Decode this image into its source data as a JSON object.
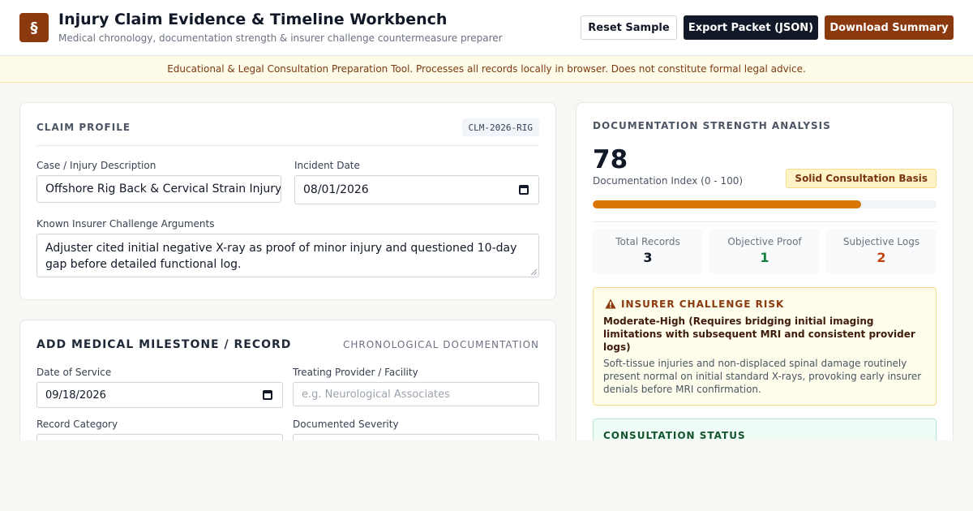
{
  "header": {
    "logo_glyph": "§",
    "title": "Injury Claim Evidence & Timeline Workbench",
    "subtitle": "Medical chronology, documentation strength & insurer challenge countermeasure preparer",
    "reset_label": "Reset Sample",
    "export_label": "Export Packet (JSON)",
    "download_label": "Download Summary"
  },
  "notice": "Educational & Legal Consultation Preparation Tool. Processes all records locally in browser. Does not constitute formal legal advice.",
  "profile": {
    "section_title": "CLAIM PROFILE",
    "case_id": "CLM-2026-RIG",
    "description_label": "Case / Injury Description",
    "description_value": "Offshore Rig Back & Cervical Strain Injury",
    "incident_label": "Incident Date",
    "incident_value": "08/01/2026",
    "challenge_label": "Known Insurer Challenge Arguments",
    "challenge_value": "Adjuster cited initial negative X-ray as proof of minor injury and questioned 10-day gap before detailed functional log."
  },
  "add_record": {
    "title": "ADD MEDICAL MILESTONE / RECORD",
    "meta": "CHRONOLOGICAL DOCUMENTATION",
    "date_label": "Date of Service",
    "date_value": "09/18/2026",
    "provider_label": "Treating Provider / Facility",
    "provider_placeholder": "e.g. Neurological Associates",
    "category_label": "Record Category",
    "severity_label": "Documented Severity"
  },
  "analysis": {
    "section_title": "DOCUMENTATION STRENGTH ANALYSIS",
    "score": "78",
    "score_label": "Documentation Index (0 - 100)",
    "score_fraction": 0.78,
    "basis_badge": "Solid Consultation Basis",
    "stats": [
      {
        "label": "Total Records",
        "value": "3",
        "color": "#111827"
      },
      {
        "label": "Objective Proof",
        "value": "1",
        "color": "#15803d"
      },
      {
        "label": "Subjective Logs",
        "value": "2",
        "color": "#c2410c"
      }
    ],
    "risk_title": "INSURER CHALLENGE RISK",
    "risk_level": "Moderate-High (Requires bridging initial imaging limitations with subsequent MRI and consistent provider logs)",
    "risk_desc": "Soft-tissue injuries and non-displaced spinal damage routinely present normal on initial standard X-rays, provoking early insurer denials before MRI confirmation.",
    "consult_title": "CONSULTATION STATUS"
  },
  "colors": {
    "brand": "#8b3a0f",
    "dark": "#111827",
    "progress": "#d97706",
    "warning_bg": "#fefcea",
    "success_bg": "#effcf5"
  }
}
